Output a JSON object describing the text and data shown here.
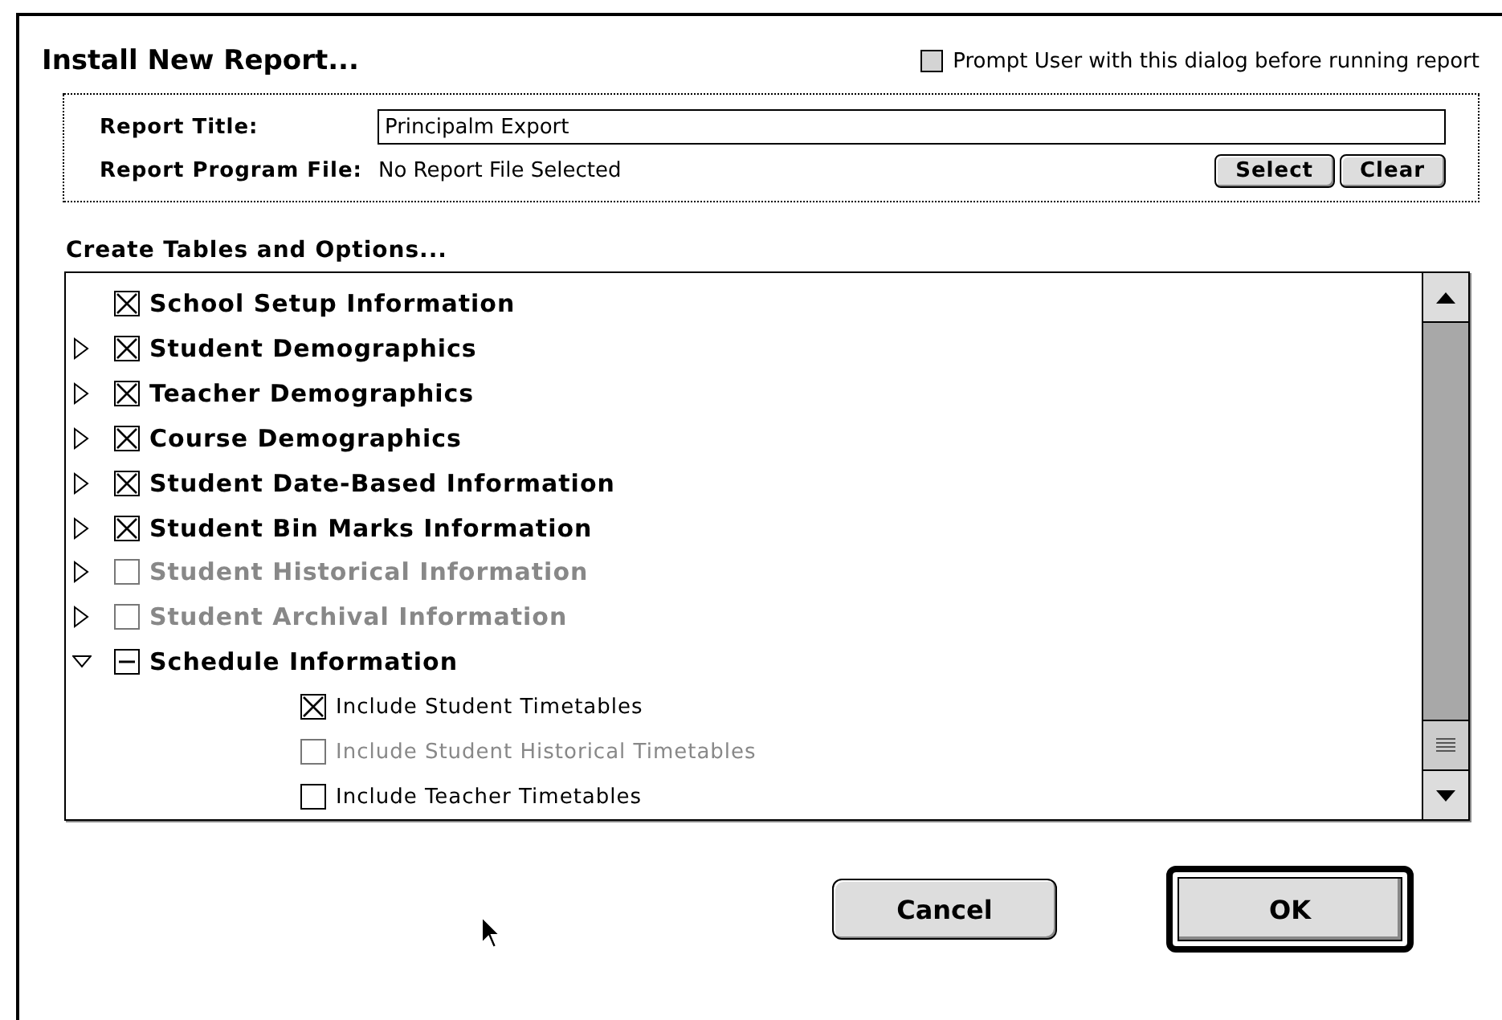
{
  "dialog": {
    "title": "Install New Report...",
    "prompt_checkbox": {
      "label": "Prompt User with this dialog before running report",
      "checked": false
    }
  },
  "report": {
    "title_label": "Report Title:",
    "title_value": "Principalm Export",
    "file_label": "Report Program File:",
    "file_value": "No Report File Selected",
    "buttons": [
      "Select",
      "Clear"
    ]
  },
  "tables": {
    "heading": "Create Tables and Options...",
    "items": [
      {
        "label": "School Setup Information",
        "checked": true,
        "mixed": false,
        "disabled": false
      },
      {
        "label": "Student Demographics",
        "checked": true,
        "mixed": false,
        "disabled": false,
        "expanded": false
      },
      {
        "label": "Teacher Demographics",
        "checked": true,
        "mixed": false,
        "disabled": false,
        "expanded": false
      },
      {
        "label": "Course Demographics",
        "checked": true,
        "mixed": false,
        "disabled": false,
        "expanded": false
      },
      {
        "label": "Student Date-Based Information",
        "checked": true,
        "mixed": false,
        "disabled": false,
        "expanded": false
      },
      {
        "label": "Student Bin Marks Information",
        "checked": true,
        "mixed": false,
        "disabled": false,
        "expanded": false
      },
      {
        "label": "Student Historical Information",
        "checked": false,
        "mixed": false,
        "disabled": true,
        "expanded": false
      },
      {
        "label": "Student Archival Information",
        "checked": false,
        "mixed": false,
        "disabled": true,
        "expanded": false
      },
      {
        "label": "Schedule Information",
        "checked": false,
        "mixed": true,
        "disabled": false,
        "expanded": true,
        "children": [
          {
            "label": "Include Student Timetables",
            "checked": true,
            "mixed": false,
            "disabled": false
          },
          {
            "label": "Include Student Historical Timetables",
            "checked": false,
            "mixed": false,
            "disabled": true
          },
          {
            "label": "Include Teacher Timetables",
            "checked": false,
            "mixed": false,
            "disabled": false
          }
        ]
      }
    ]
  },
  "buttons": [
    {
      "label": "Cancel",
      "default": false
    },
    {
      "label": "OK",
      "default": true
    }
  ]
}
